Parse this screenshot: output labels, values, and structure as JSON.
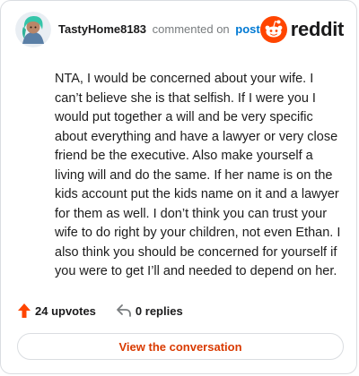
{
  "header": {
    "username": "TastyHome8183",
    "commented_text": "commented on",
    "post_link": "post",
    "brand": "reddit"
  },
  "comment": {
    "body": "NTA, I would be concerned about your wife. I can’t believe she is that selfish. If I were you I would put together a will and be very specific about everything and have a lawyer or very close friend be the executive. Also make yourself a living will and do the same. If her name is on the kids account put the kids name on it and a lawyer for them as well. I don’t think you can trust your wife to do right by your children, not even Ethan. I also think you should be concerned for yourself if you were to get I’ll and needed to depend on her."
  },
  "actions": {
    "upvotes": "24 upvotes",
    "replies": "0 replies"
  },
  "cta": {
    "view_label": "View the conversation"
  },
  "icons": {
    "avatar": "avatar-icon",
    "reddit_logo": "reddit-logo-icon",
    "upvote": "upvote-arrow-icon",
    "reply": "reply-arrow-icon"
  },
  "colors": {
    "reddit_orange": "#ff4500",
    "link_blue": "#0079d3",
    "cta_orange": "#d93a00",
    "upvote_orange": "#ff4500",
    "muted_gray": "#787c7e",
    "border": "#dadde1"
  }
}
